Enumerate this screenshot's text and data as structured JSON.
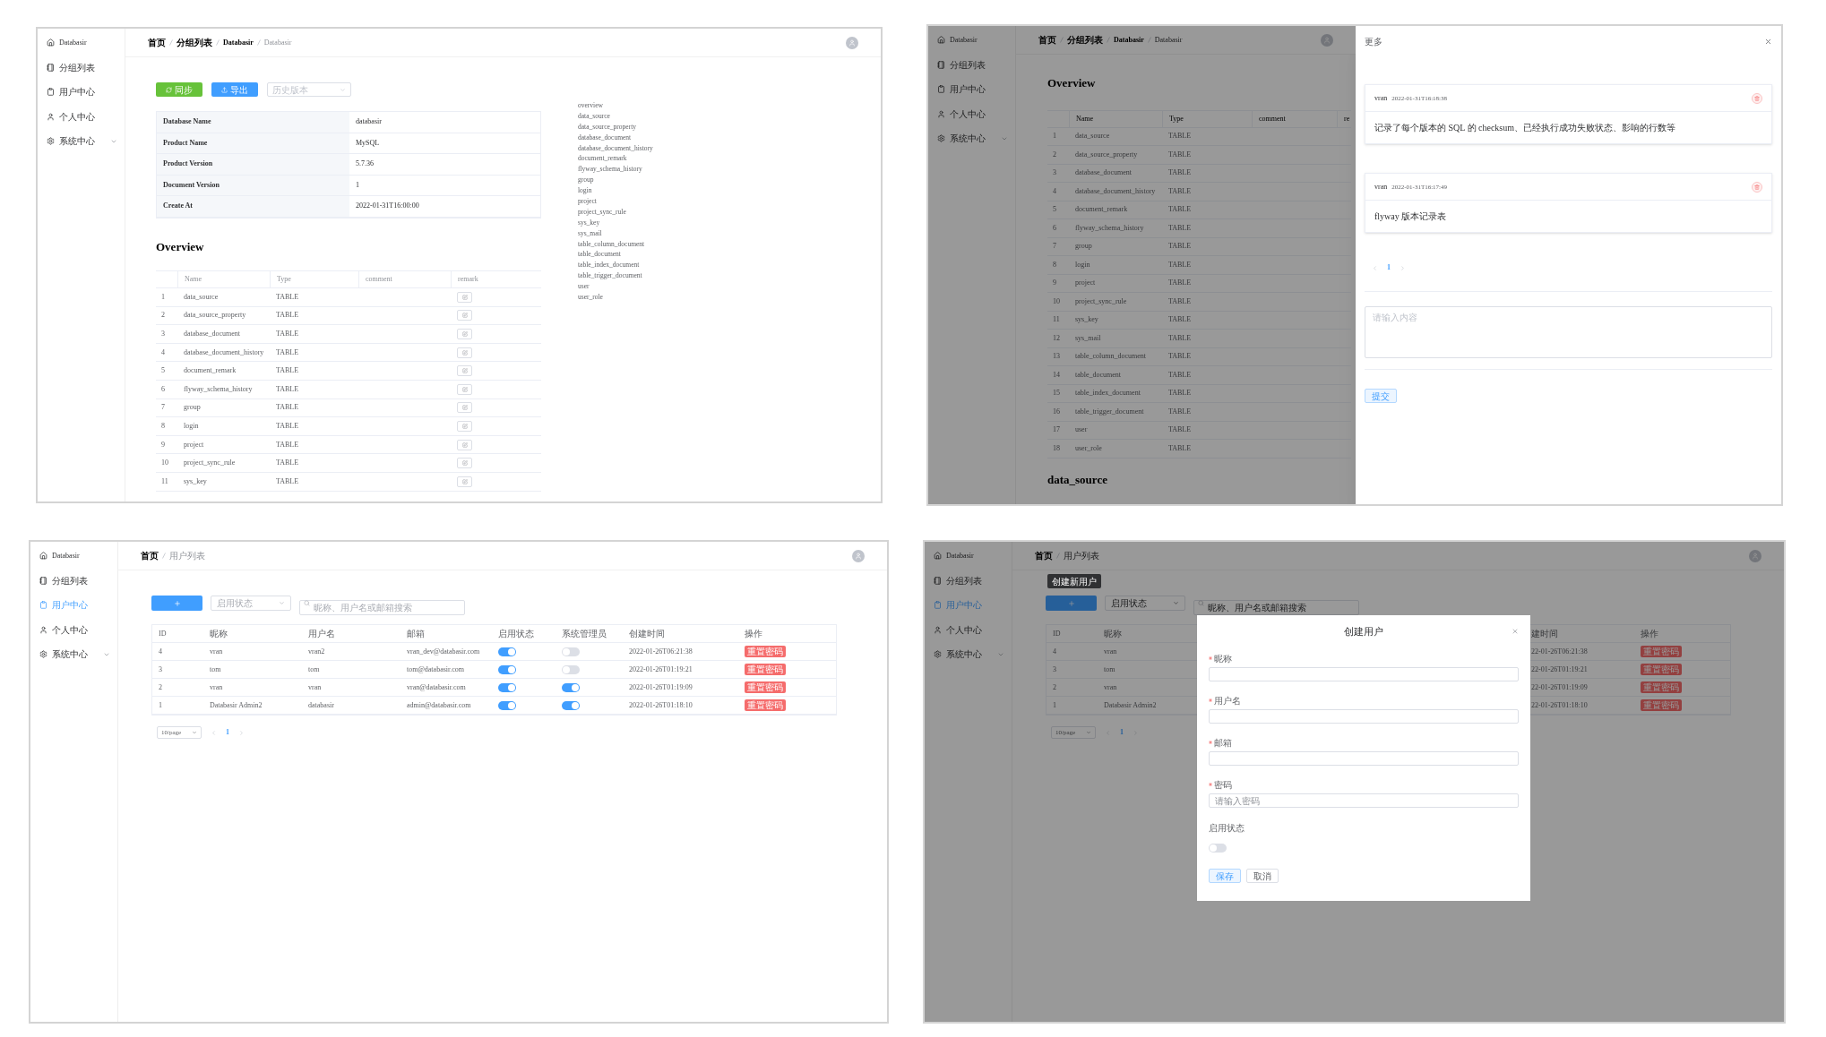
{
  "database_view": {
    "sidebar": [
      {
        "label": "Databasir",
        "selected": false
      },
      {
        "label": "分组列表",
        "selected": false
      },
      {
        "label": "用户中心",
        "selected": false
      },
      {
        "label": "个人中心",
        "selected": false
      },
      {
        "label": "系统中心",
        "selected": false
      }
    ],
    "breadcrumb": [
      "首页",
      "分组列表",
      "Databasir",
      "Databasir"
    ],
    "sync_button": "同步",
    "export_button": "导出",
    "version_select": {
      "placeholder": "历史版本"
    },
    "info": [
      {
        "label": "Database Name",
        "value": "databasir"
      },
      {
        "label": "Product Name",
        "value": "MySQL"
      },
      {
        "label": "Product Version",
        "value": "5.7.36"
      },
      {
        "label": "Document Version",
        "value": "1"
      },
      {
        "label": "Create At",
        "value": "2022-01-31T16:00:00"
      }
    ],
    "overview_title": "Overview",
    "table": {
      "columns": [
        "Name",
        "Type",
        "comment",
        "remark"
      ],
      "rows": [
        {
          "index": "1",
          "name": "data_source",
          "type": "TABLE"
        },
        {
          "index": "2",
          "name": "data_source_property",
          "type": "TABLE"
        },
        {
          "index": "3",
          "name": "database_document",
          "type": "TABLE"
        },
        {
          "index": "4",
          "name": "database_document_history",
          "type": "TABLE"
        },
        {
          "index": "5",
          "name": "document_remark",
          "type": "TABLE"
        },
        {
          "index": "6",
          "name": "flyway_schema_history",
          "type": "TABLE"
        },
        {
          "index": "7",
          "name": "group",
          "type": "TABLE"
        },
        {
          "index": "8",
          "name": "login",
          "type": "TABLE"
        },
        {
          "index": "9",
          "name": "project",
          "type": "TABLE"
        },
        {
          "index": "10",
          "name": "project_sync_rule",
          "type": "TABLE"
        },
        {
          "index": "11",
          "name": "sys_key",
          "type": "TABLE"
        }
      ]
    },
    "toc": [
      "overview",
      "data_source",
      "data_source_property",
      "database_document",
      "database_document_history",
      "document_remark",
      "flyway_schema_history",
      "group",
      "login",
      "project",
      "project_sync_rule",
      "sys_key",
      "sys_mail",
      "table_column_document",
      "table_document",
      "table_index_document",
      "table_trigger_document",
      "user",
      "user_role"
    ]
  },
  "remarks_view": {
    "sidebar": [
      {
        "label": "Databasir",
        "selected": false
      },
      {
        "label": "分组列表",
        "selected": false
      },
      {
        "label": "用户中心",
        "selected": false
      },
      {
        "label": "个人中心",
        "selected": false
      },
      {
        "label": "系统中心",
        "selected": false
      }
    ],
    "breadcrumb": [
      "首页",
      "分组列表",
      "Databasir",
      "Databasir"
    ],
    "overview_title": "Overview",
    "table": {
      "columns": [
        "Name",
        "Type",
        "comment",
        "re"
      ],
      "rows": [
        {
          "index": "1",
          "name": "data_source",
          "type": "TABLE"
        },
        {
          "index": "2",
          "name": "data_source_property",
          "type": "TABLE"
        },
        {
          "index": "3",
          "name": "database_document",
          "type": "TABLE"
        },
        {
          "index": "4",
          "name": "database_document_history",
          "type": "TABLE"
        },
        {
          "index": "5",
          "name": "document_remark",
          "type": "TABLE"
        },
        {
          "index": "6",
          "name": "flyway_schema_history",
          "type": "TABLE"
        },
        {
          "index": "7",
          "name": "group",
          "type": "TABLE"
        },
        {
          "index": "8",
          "name": "login",
          "type": "TABLE"
        },
        {
          "index": "9",
          "name": "project",
          "type": "TABLE"
        },
        {
          "index": "10",
          "name": "project_sync_rule",
          "type": "TABLE"
        },
        {
          "index": "11",
          "name": "sys_key",
          "type": "TABLE"
        },
        {
          "index": "12",
          "name": "sys_mail",
          "type": "TABLE"
        },
        {
          "index": "13",
          "name": "table_column_document",
          "type": "TABLE"
        },
        {
          "index": "14",
          "name": "table_document",
          "type": "TABLE"
        },
        {
          "index": "15",
          "name": "table_index_document",
          "type": "TABLE"
        },
        {
          "index": "16",
          "name": "table_trigger_document",
          "type": "TABLE"
        },
        {
          "index": "17",
          "name": "user",
          "type": "TABLE"
        },
        {
          "index": "18",
          "name": "user_role",
          "type": "TABLE"
        }
      ]
    },
    "next_section_title": "data_source",
    "drawer": {
      "title": "更多",
      "remarks": [
        {
          "author": "vran",
          "time": "2022-01-31T16:18:38",
          "content": "记录了每个版本的 SQL 的 checksum、已经执行成功失败状态、影响的行数等"
        },
        {
          "author": "vran",
          "time": "2022-01-31T16:17:49",
          "content": "flyway 版本记录表"
        }
      ],
      "pagination": {
        "pages": [
          {
            "label": "1",
            "selected": true
          }
        ]
      },
      "input": {
        "placeholder": "请输入内容"
      },
      "submit_button": "提交"
    }
  },
  "user_list_view": {
    "sidebar": [
      {
        "label": "Databasir",
        "selected": false
      },
      {
        "label": "分组列表",
        "selected": false
      },
      {
        "label": "用户中心",
        "selected": true
      },
      {
        "label": "个人中心",
        "selected": false
      },
      {
        "label": "系统中心",
        "selected": false
      }
    ],
    "breadcrumb": [
      "首页",
      "用户列表"
    ],
    "status_select": {
      "placeholder": "启用状态"
    },
    "search": {
      "placeholder": "昵称、用户名或邮箱搜索"
    },
    "table": {
      "columns": [
        "ID",
        "昵称",
        "用户名",
        "邮箱",
        "启用状态",
        "系统管理员",
        "创建时间",
        "操作"
      ],
      "rows": [
        {
          "id": "4",
          "nickname": "vran",
          "username": "vran2",
          "email": "vran_dev@databasir.com",
          "enabled": true,
          "is_admin": false,
          "created_at": "2022-01-26T06:21:38",
          "action": "重置密码"
        },
        {
          "id": "3",
          "nickname": "tom",
          "username": "tom",
          "email": "tom@databasir.com",
          "enabled": true,
          "is_admin": false,
          "created_at": "2022-01-26T01:19:21",
          "action": "重置密码"
        },
        {
          "id": "2",
          "nickname": "vran",
          "username": "vran",
          "email": "vran@databasir.com",
          "enabled": true,
          "is_admin": true,
          "created_at": "2022-01-26T01:19:09",
          "action": "重置密码"
        },
        {
          "id": "1",
          "nickname": "Databasir Admin2",
          "username": "databasir",
          "email": "admin@databasir.com",
          "enabled": true,
          "is_admin": true,
          "created_at": "2022-01-26T01:18:10",
          "action": "重置密码"
        }
      ]
    },
    "pagination": {
      "page_size": "10/page",
      "pages": [
        {
          "label": "1",
          "selected": true
        }
      ]
    }
  },
  "create_user_view": {
    "sidebar": [
      {
        "label": "Databasir",
        "selected": false
      },
      {
        "label": "分组列表",
        "selected": false
      },
      {
        "label": "用户中心",
        "selected": true
      },
      {
        "label": "个人中心",
        "selected": false
      },
      {
        "label": "系统中心",
        "selected": false
      }
    ],
    "breadcrumb": [
      "首页",
      "用户列表"
    ],
    "tooltip": "创建新用户",
    "status_select": {
      "placeholder": "启用状态"
    },
    "search": {
      "placeholder": "昵称、用户名或邮箱搜索"
    },
    "table": {
      "columns": [
        "ID",
        "昵称",
        "建时间",
        "操作"
      ],
      "rows": [
        {
          "id": "4",
          "nickname": "vran",
          "created_at": "22-01-26T06:21:38",
          "action": "重置密码"
        },
        {
          "id": "3",
          "nickname": "tom",
          "created_at": "22-01-26T01:19:21",
          "action": "重置密码"
        },
        {
          "id": "2",
          "nickname": "vran",
          "created_at": "22-01-26T01:19:09",
          "action": "重置密码"
        },
        {
          "id": "1",
          "nickname": "Databasir Admin2",
          "created_at": "22-01-26T01:18:10",
          "action": "重置密码"
        }
      ]
    },
    "pagination": {
      "page_size": "10/page",
      "pages": [
        {
          "label": "1",
          "selected": true
        }
      ]
    },
    "modal": {
      "title": "创建用户",
      "fields": [
        {
          "label": "昵称",
          "required": true
        },
        {
          "label": "用户名",
          "required": true
        },
        {
          "label": "邮箱",
          "required": true
        },
        {
          "label": "密码",
          "required": true,
          "placeholder": "请输入密码"
        }
      ],
      "status_switch": {
        "label": "启用状态",
        "on": false
      },
      "save_button": "保存",
      "cancel_button": "取消"
    }
  }
}
